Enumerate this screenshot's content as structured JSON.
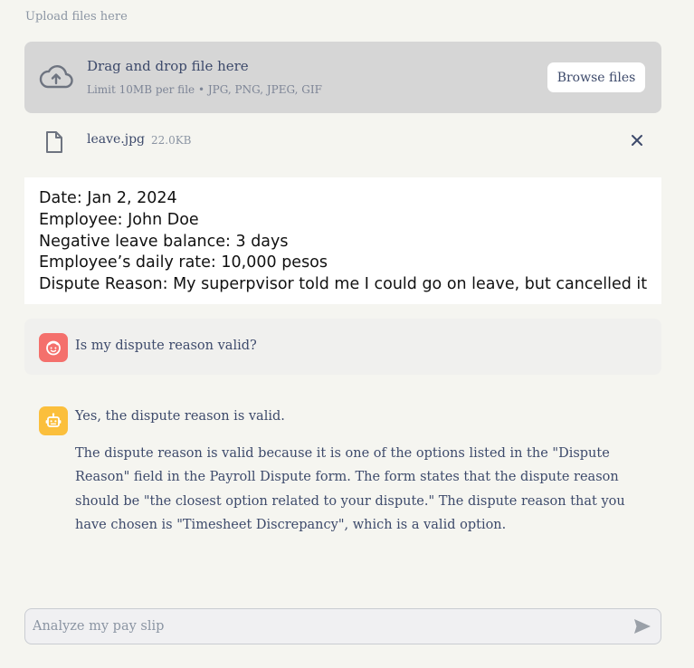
{
  "uploader": {
    "label": "Upload files here",
    "drop_title": "Drag and drop file here",
    "drop_subtitle": "Limit 10MB per file • JPG, PNG, JPEG, GIF",
    "browse_label": "Browse files"
  },
  "file": {
    "name": "leave.jpg",
    "size": "22.0KB"
  },
  "image_preview": {
    "lines": [
      "Date: Jan 2, 2024",
      "Employee: John Doe",
      "Negative leave balance: 3 days",
      "Employee’s daily rate: 10,000 pesos",
      "Dispute Reason: My superpvisor told me I could go on leave, but cancelled it"
    ]
  },
  "chat": {
    "user_message": "Is my dispute reason valid?",
    "bot_first": "Yes, the dispute reason is valid.",
    "bot_paragraph": "The dispute reason is valid because it is one of the options listed in the \"Dispute Reason\" field in the Payroll Dispute form. The form states that the dispute reason should be \"the closest option related to your dispute.\" The dispute reason that you have chosen is \"Timesheet Discrepancy\", which is a valid option."
  },
  "chat_input": {
    "placeholder": "Analyze my pay slip"
  },
  "icons": {
    "upload": "cloud-upload-icon",
    "file": "file-icon",
    "close": "close-icon",
    "user_avatar": "user-avatar-icon",
    "bot_avatar": "robot-avatar-icon",
    "send": "send-icon"
  },
  "colors": {
    "user_avatar": "#f4706c",
    "bot_avatar": "#fbbf3c",
    "text": "#3d4a6b"
  }
}
